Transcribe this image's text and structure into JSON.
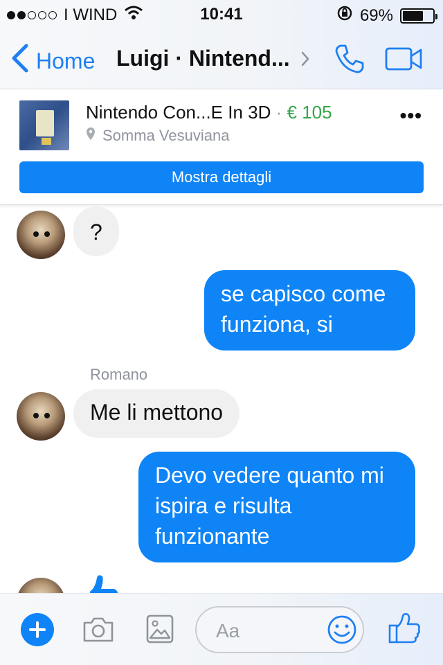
{
  "status_bar": {
    "carrier": "I WIND",
    "time": "10:41",
    "battery_percent": "69%",
    "battery_level": 0.69,
    "signal_bars_filled": 2,
    "signal_bars_total": 5
  },
  "nav": {
    "back_label": "Home",
    "title": "Luigi · Nintend..."
  },
  "listing": {
    "title": "Nintendo  Con...E In 3D",
    "separator": "·",
    "price": "€ 105",
    "location": "Somma Vesuviana",
    "more": "•••",
    "details_button": "Mostra dettagli"
  },
  "messages": [
    {
      "direction": "in",
      "text": "?"
    },
    {
      "direction": "out",
      "text": "se capisco come funziona, si"
    },
    {
      "direction": "in",
      "sender": "Romano",
      "text": "Me li mettono"
    },
    {
      "direction": "out",
      "text": "Devo vedere quanto mi ispira e risulta funzionante"
    }
  ],
  "composer": {
    "placeholder": "Aa"
  },
  "colors": {
    "accent": "#0f84f7",
    "price_green": "#35a64a",
    "incoming_bubble": "#f1f0f0"
  }
}
